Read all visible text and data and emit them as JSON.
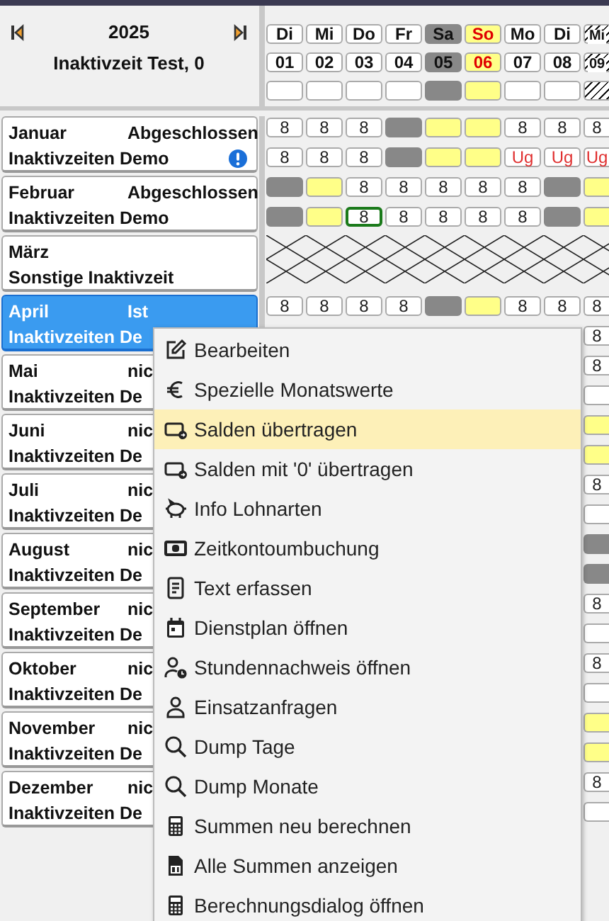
{
  "header": {
    "year": "2025",
    "person": "Inaktivzeit Test, 0"
  },
  "days": [
    {
      "weekday": "Di",
      "date": "01",
      "kind": "workday"
    },
    {
      "weekday": "Mi",
      "date": "02",
      "kind": "workday"
    },
    {
      "weekday": "Do",
      "date": "03",
      "kind": "workday"
    },
    {
      "weekday": "Fr",
      "date": "04",
      "kind": "workday"
    },
    {
      "weekday": "Sa",
      "date": "05",
      "kind": "saturday"
    },
    {
      "weekday": "So",
      "date": "06",
      "kind": "sunday"
    },
    {
      "weekday": "Mo",
      "date": "07",
      "kind": "workday"
    },
    {
      "weekday": "Di",
      "date": "08",
      "kind": "workday"
    },
    {
      "weekday": "Mi",
      "date": "09",
      "kind": "hatched"
    }
  ],
  "months": [
    {
      "name": "Januar",
      "status": "Abgeschlossen",
      "group": "Inaktivzeiten Demo",
      "selected": false,
      "alert": true,
      "kind": "plan",
      "rows": [
        [
          {
            "kind": "value",
            "text": "8",
            "selected": false
          },
          {
            "kind": "value",
            "text": "8",
            "selected": false
          },
          {
            "kind": "value",
            "text": "8",
            "selected": false
          },
          {
            "kind": "saturday"
          },
          {
            "kind": "sunday"
          },
          {
            "kind": "sunday"
          },
          {
            "kind": "value",
            "text": "8",
            "selected": false
          },
          {
            "kind": "value",
            "text": "8",
            "selected": false
          },
          {
            "kind": "value",
            "text": "8",
            "selected": false
          }
        ],
        [
          {
            "kind": "value",
            "text": "8",
            "selected": false
          },
          {
            "kind": "value",
            "text": "8",
            "selected": false
          },
          {
            "kind": "value",
            "text": "8",
            "selected": false
          },
          {
            "kind": "saturday"
          },
          {
            "kind": "sunday"
          },
          {
            "kind": "sunday"
          },
          {
            "kind": "absence",
            "text": "Ug",
            "selected": false
          },
          {
            "kind": "absence",
            "text": "Ug",
            "selected": false
          },
          {
            "kind": "absence",
            "text": "Ug",
            "selected": false
          }
        ]
      ]
    },
    {
      "name": "Februar",
      "status": "Abgeschlossen",
      "group": "Inaktivzeiten Demo",
      "selected": false,
      "alert": false,
      "kind": "plan",
      "rows": [
        [
          {
            "kind": "saturday"
          },
          {
            "kind": "sunday"
          },
          {
            "kind": "value",
            "text": "8",
            "selected": false
          },
          {
            "kind": "value",
            "text": "8",
            "selected": false
          },
          {
            "kind": "value",
            "text": "8",
            "selected": false
          },
          {
            "kind": "value",
            "text": "8",
            "selected": false
          },
          {
            "kind": "value",
            "text": "8",
            "selected": false
          },
          {
            "kind": "saturday"
          },
          {
            "kind": "sunday"
          }
        ],
        [
          {
            "kind": "saturday"
          },
          {
            "kind": "sunday"
          },
          {
            "kind": "value",
            "text": "8",
            "selected": true
          },
          {
            "kind": "value",
            "text": "8",
            "selected": false
          },
          {
            "kind": "value",
            "text": "8",
            "selected": false
          },
          {
            "kind": "value",
            "text": "8",
            "selected": false
          },
          {
            "kind": "value",
            "text": "8",
            "selected": false
          },
          {
            "kind": "saturday"
          },
          {
            "kind": "sunday"
          }
        ]
      ]
    },
    {
      "name": "März",
      "group": "Sonstige Inaktivzeit",
      "selected": false,
      "alert": false,
      "kind": "unavailable"
    },
    {
      "name": "April",
      "status": "Ist",
      "group": "Inaktivzeiten De",
      "selected": true,
      "alert": false,
      "kind": "plan",
      "rows": [
        [
          {
            "kind": "value",
            "text": "8",
            "selected": false
          },
          {
            "kind": "value",
            "text": "8",
            "selected": false
          },
          {
            "kind": "value",
            "text": "8",
            "selected": false
          },
          {
            "kind": "value",
            "text": "8",
            "selected": false
          },
          {
            "kind": "saturday"
          },
          {
            "kind": "sunday"
          },
          {
            "kind": "value",
            "text": "8",
            "selected": false
          },
          {
            "kind": "value",
            "text": "8",
            "selected": false
          },
          {
            "kind": "value",
            "text": "8",
            "selected": false
          }
        ],
        [
          "",
          "",
          "",
          "",
          "",
          "",
          "",
          "",
          {
            "kind": "value",
            "text": "8",
            "selected": false
          }
        ]
      ]
    },
    {
      "name": "Mai",
      "status": "nic",
      "group": "Inaktivzeiten De",
      "selected": false,
      "alert": false,
      "kind": "plan",
      "rows": [
        [
          "",
          "",
          "",
          "",
          "",
          "",
          "",
          "",
          {
            "kind": "value",
            "text": "8",
            "selected": false
          }
        ],
        [
          "",
          "",
          "",
          "",
          "",
          "",
          "",
          "",
          {
            "kind": "empty"
          }
        ]
      ]
    },
    {
      "name": "Juni",
      "status": "nic",
      "group": "Inaktivzeiten De",
      "selected": false,
      "alert": false,
      "kind": "plan",
      "rows": [
        [
          "",
          "",
          "",
          "",
          "",
          "",
          "",
          "",
          {
            "kind": "sunday"
          }
        ],
        [
          "",
          "",
          "",
          "",
          "",
          "",
          "",
          "",
          {
            "kind": "sunday"
          }
        ]
      ]
    },
    {
      "name": "Juli",
      "status": "nic",
      "group": "Inaktivzeiten De",
      "selected": false,
      "alert": false,
      "kind": "plan",
      "rows": [
        [
          "",
          "",
          "",
          "",
          "",
          "",
          "",
          "",
          {
            "kind": "value",
            "text": "8",
            "selected": false
          }
        ],
        [
          "",
          "",
          "",
          "",
          "",
          "",
          "",
          "",
          {
            "kind": "empty"
          }
        ]
      ]
    },
    {
      "name": "August",
      "status": "nic",
      "group": "Inaktivzeiten De",
      "selected": false,
      "alert": false,
      "kind": "plan",
      "rows": [
        [
          "",
          "",
          "",
          "",
          "",
          "",
          "",
          "",
          {
            "kind": "saturday"
          }
        ],
        [
          "",
          "",
          "",
          "",
          "",
          "",
          "",
          "",
          {
            "kind": "saturday"
          }
        ]
      ]
    },
    {
      "name": "September",
      "status": "nic",
      "group": "Inaktivzeiten De",
      "selected": false,
      "alert": false,
      "kind": "plan",
      "rows": [
        [
          "",
          "",
          "",
          "",
          "",
          "",
          "",
          "",
          {
            "kind": "value",
            "text": "8",
            "selected": false
          }
        ],
        [
          "",
          "",
          "",
          "",
          "",
          "",
          "",
          "",
          {
            "kind": "empty"
          }
        ]
      ]
    },
    {
      "name": "Oktober",
      "status": "nic",
      "group": "Inaktivzeiten De",
      "selected": false,
      "alert": false,
      "kind": "plan",
      "rows": [
        [
          "",
          "",
          "",
          "",
          "",
          "",
          "",
          "",
          {
            "kind": "value",
            "text": "8",
            "selected": false
          }
        ],
        [
          "",
          "",
          "",
          "",
          "",
          "",
          "",
          "",
          {
            "kind": "empty"
          }
        ]
      ]
    },
    {
      "name": "November",
      "status": "nic",
      "group": "Inaktivzeiten De",
      "selected": false,
      "alert": false,
      "kind": "plan",
      "rows": [
        [
          "",
          "",
          "",
          "",
          "",
          "",
          "",
          "",
          {
            "kind": "sunday"
          }
        ],
        [
          "",
          "",
          "",
          "",
          "",
          "",
          "",
          "",
          {
            "kind": "sunday"
          }
        ]
      ]
    },
    {
      "name": "Dezember",
      "status": "nic",
      "group": "Inaktivzeiten De",
      "selected": false,
      "alert": false,
      "kind": "plan",
      "rows": [
        [
          "",
          "",
          "",
          "",
          "",
          "",
          "",
          "",
          {
            "kind": "value",
            "text": "8",
            "selected": false
          }
        ],
        [
          "",
          "",
          "",
          "",
          "",
          "",
          "",
          "",
          {
            "kind": "empty"
          }
        ]
      ]
    }
  ],
  "context_menu": {
    "items": [
      {
        "label": "Bearbeiten",
        "selected": false
      },
      {
        "label": "Spezielle Monatswerte",
        "selected": false
      },
      {
        "label": "Salden übertragen",
        "selected": true
      },
      {
        "label": "Salden mit '0' übertragen",
        "selected": false
      },
      {
        "label": "Info Lohnarten",
        "selected": false
      },
      {
        "label": "Zeitkontoumbuchung",
        "selected": false
      },
      {
        "label": "Text erfassen",
        "selected": false
      },
      {
        "label": "Dienstplan öffnen",
        "selected": false
      },
      {
        "label": "Stundennachweis öffnen",
        "selected": false
      },
      {
        "label": "Einsatzanfragen",
        "selected": false
      },
      {
        "label": "Dump Tage",
        "selected": false
      },
      {
        "label": "Dump Monate",
        "selected": false
      },
      {
        "label": "Summen neu berechnen",
        "selected": false
      },
      {
        "label": "Alle Summen anzeigen",
        "selected": false
      },
      {
        "label": "Berechnungsdialog öffnen",
        "selected": false
      }
    ]
  }
}
